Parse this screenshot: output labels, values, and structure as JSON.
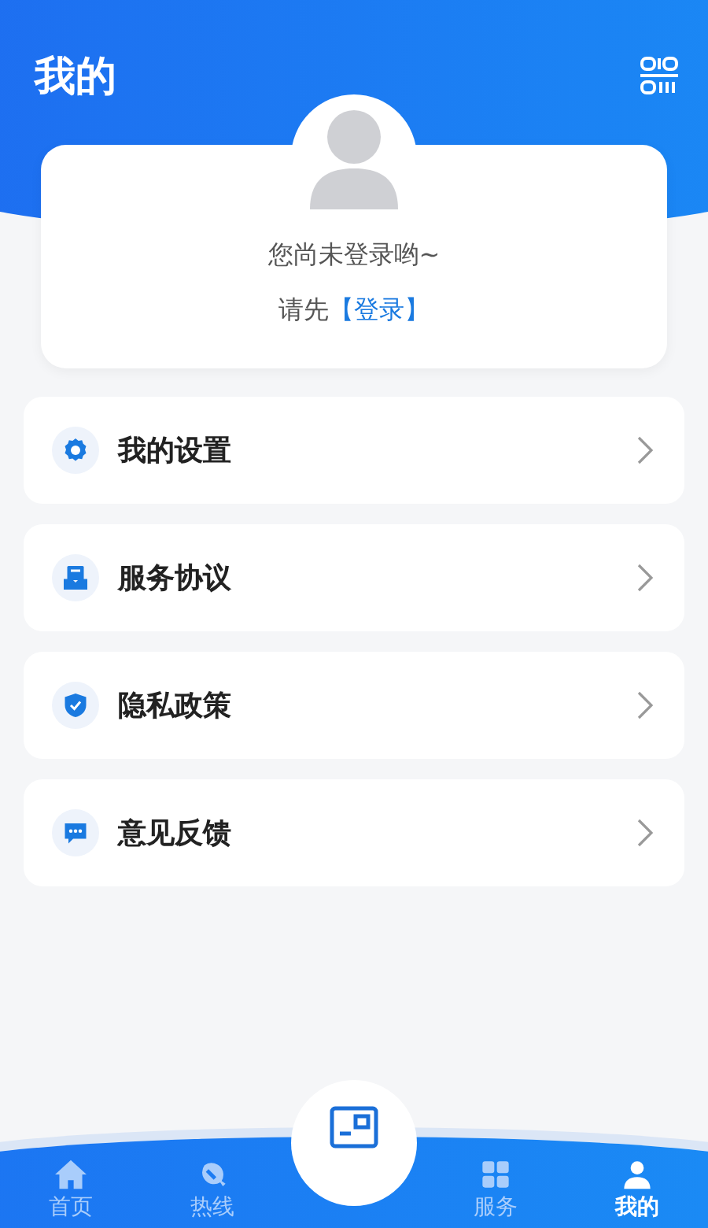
{
  "header": {
    "title": "我的"
  },
  "profile": {
    "status": "您尚未登录哟~",
    "prompt": "请先",
    "login_link": "【登录】"
  },
  "menu": [
    {
      "kind": "settings",
      "label": "我的设置"
    },
    {
      "kind": "agreement",
      "label": "服务协议"
    },
    {
      "kind": "privacy",
      "label": "隐私政策"
    },
    {
      "kind": "feedback",
      "label": "意见反馈"
    }
  ],
  "tab_bar": [
    {
      "kind": "home",
      "label": "首页",
      "selected": false
    },
    {
      "kind": "hotline",
      "label": "热线",
      "selected": false
    },
    {
      "kind": "card",
      "selected": false
    },
    {
      "kind": "service",
      "label": "服务",
      "selected": false
    },
    {
      "kind": "mine",
      "label": "我的",
      "selected": true
    }
  ]
}
